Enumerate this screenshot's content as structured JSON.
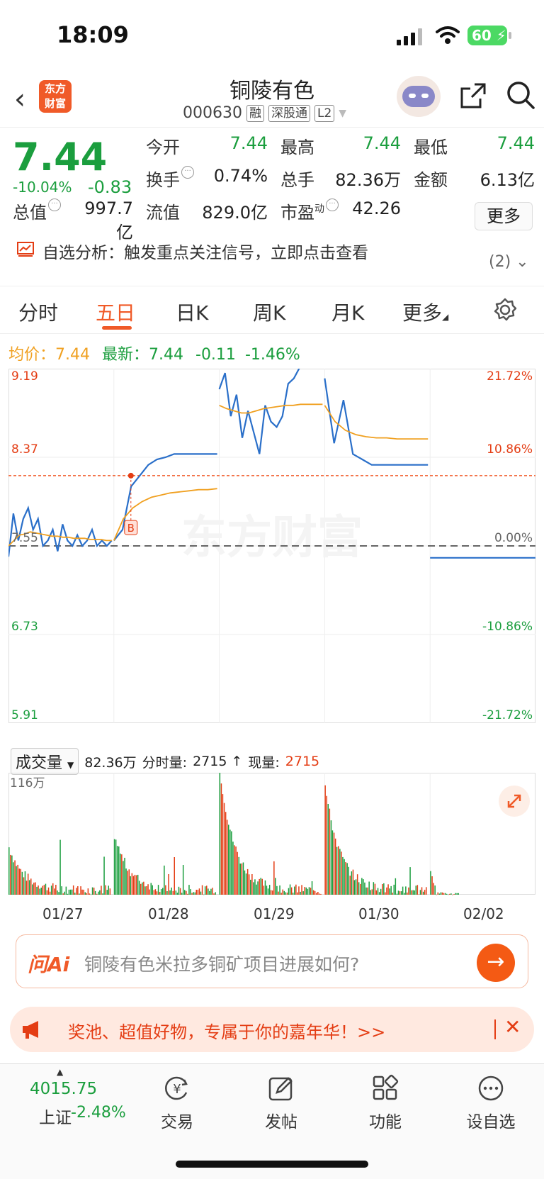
{
  "status": {
    "time": "18:09",
    "battery": "60"
  },
  "header": {
    "logo": "东方\n财富",
    "title": "铜陵有色",
    "code": "000630",
    "tags": [
      "融",
      "深股通",
      "L2"
    ]
  },
  "quote": {
    "price": "7.44",
    "pct": "-10.04%",
    "change": "-0.83",
    "open_label": "今开",
    "open": "7.44",
    "high_label": "最高",
    "high": "7.44",
    "low_label": "最低",
    "low": "7.44",
    "turnover_label": "换手",
    "turnover": "0.74%",
    "volume_label": "总手",
    "volume": "82.36万",
    "amount_label": "金额",
    "amount": "6.13亿",
    "mcap_label": "总值",
    "mcap": "997.7亿",
    "float_label": "流值",
    "float": "829.0亿",
    "pe_label": "市盈",
    "pe_sup": "动",
    "pe": "42.26",
    "more": "更多"
  },
  "alert": {
    "text": "自选分析：触发重点关注信号，立即点击查看",
    "count": "(2)"
  },
  "tabs": [
    "分时",
    "五日",
    "日K",
    "周K",
    "月K",
    "更多"
  ],
  "active_tab": 1,
  "avg": {
    "label": "均价：",
    "value": "7.44",
    "latest_label": "最新：",
    "latest": "7.44",
    "chg": "-0.11",
    "pct": "-1.46%"
  },
  "chart_data": {
    "type": "line",
    "y_left_ticks": [
      "9.19",
      "8.37",
      "7.55",
      "6.73",
      "5.91"
    ],
    "y_right_ticks": [
      "21.72%",
      "10.86%",
      "0.00%",
      "-10.86%",
      "-21.72%"
    ],
    "ylim": [
      5.91,
      9.19
    ],
    "x_dates": [
      "01/27",
      "01/28",
      "01/29",
      "01/30",
      "02/02"
    ],
    "reference_line": 8.2,
    "marker": "B",
    "watermark": "东方财富",
    "series": [
      {
        "name": "价格",
        "color": "#2a6fc9",
        "days": [
          [
            7.45,
            7.85,
            7.6,
            7.8,
            7.9,
            7.7,
            7.8,
            7.55,
            7.6,
            7.7,
            7.5,
            7.75,
            7.6,
            7.55,
            7.65,
            7.55,
            7.6,
            7.7,
            7.55,
            7.6,
            7.55,
            7.6
          ],
          [
            7.6,
            7.7,
            8.1,
            8.2,
            8.3,
            8.35,
            8.37,
            8.4,
            8.4,
            8.4,
            8.4,
            8.4,
            8.4
          ],
          [
            9.0,
            9.15,
            8.75,
            8.95,
            8.55,
            8.8,
            8.6,
            8.4,
            8.85,
            8.7,
            8.65,
            8.75,
            9.05,
            9.1,
            9.2,
            9.2,
            9.2,
            9.2,
            9.2
          ],
          [
            9.1,
            8.5,
            8.9,
            8.4,
            8.35,
            8.3,
            8.3,
            8.3,
            8.3,
            8.3,
            8.3,
            8.3
          ],
          [
            7.44,
            7.44,
            7.44,
            7.44
          ]
        ]
      },
      {
        "name": "均价",
        "color": "#f0a020",
        "days": [
          [
            7.55,
            7.6,
            7.65,
            7.66,
            7.68,
            7.67,
            7.66,
            7.65,
            7.64,
            7.64,
            7.63,
            7.63,
            7.62,
            7.62,
            7.62,
            7.61,
            7.61,
            7.61,
            7.6,
            7.6
          ],
          [
            7.6,
            7.8,
            7.9,
            7.96,
            8.0,
            8.02,
            8.04,
            8.05,
            8.06,
            8.07,
            8.07,
            8.08
          ],
          [
            8.85,
            8.82,
            8.8,
            8.78,
            8.78,
            8.8,
            8.82,
            8.83,
            8.84,
            8.85,
            8.85,
            8.86,
            8.86,
            8.86,
            8.86
          ],
          [
            8.85,
            8.7,
            8.62,
            8.58,
            8.56,
            8.55,
            8.55,
            8.54,
            8.54,
            8.54,
            8.54
          ]
        ]
      }
    ]
  },
  "volume": {
    "selector": "成交量",
    "total": "82.36万",
    "tick_label": "分时量:",
    "tick": "2715",
    "now_label": "现量:",
    "now": "2715",
    "max_label": "116万"
  },
  "ai": {
    "logo": "问Ai",
    "text": "铜陵有色米拉多铜矿项目进展如何?"
  },
  "promo": {
    "text": "奖池、超值好物，专属于你的嘉年华！>>"
  },
  "bottom": {
    "index_value": "4015.75",
    "index_name": "上证",
    "index_pct": "-2.48%",
    "nav": [
      "交易",
      "发帖",
      "功能",
      "设自选"
    ]
  }
}
